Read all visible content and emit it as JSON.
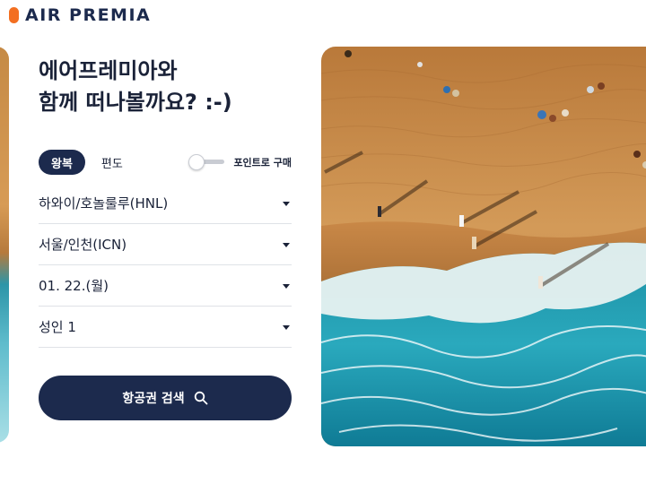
{
  "brand": {
    "name": "AIR PREMIA",
    "accent": "#f36f21",
    "navy": "#1c2a4d"
  },
  "headline": {
    "line1": "에어프레미아와",
    "line2": "함께 떠나볼까요? :-)"
  },
  "trip_type": {
    "round_trip": "왕복",
    "one_way": "편도",
    "selected": "왕복"
  },
  "points_toggle": {
    "label": "포인트로 구매",
    "enabled": false
  },
  "form": {
    "origin": "하와이/호놀룰루(HNL)",
    "destination": "서울/인천(ICN)",
    "date": "01. 22.(월)",
    "passengers": "성인 1"
  },
  "search_button": {
    "label": "항공권 검색",
    "icon": "search-icon"
  }
}
